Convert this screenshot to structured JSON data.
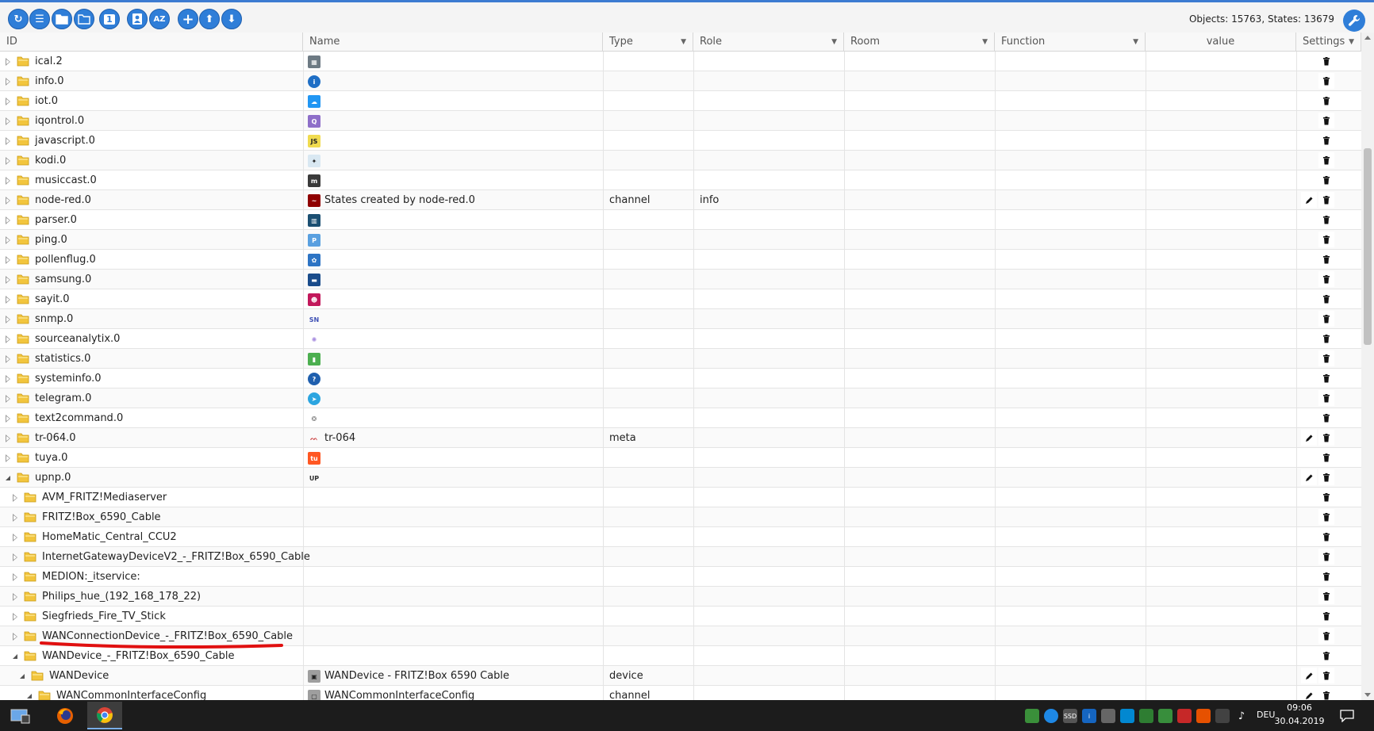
{
  "toolbar": {
    "buttons": [
      {
        "name": "refresh",
        "glyph": "↻"
      },
      {
        "name": "list-view",
        "glyph": "☰"
      },
      {
        "name": "collapse-all",
        "glyph": ""
      },
      {
        "name": "expand-all",
        "glyph": ""
      },
      {
        "name": "level",
        "glyph": "1"
      },
      {
        "name": "edit-object",
        "glyph": ""
      },
      {
        "name": "sort",
        "glyph": "AZ"
      },
      {
        "name": "add",
        "glyph": "+"
      },
      {
        "name": "upload",
        "glyph": "⬆"
      },
      {
        "name": "download",
        "glyph": "⬇"
      }
    ],
    "counts": "Objects: 15763, States: 13679"
  },
  "columns": [
    {
      "key": "id",
      "label": "ID",
      "filter": false
    },
    {
      "key": "name",
      "label": "Name",
      "filter": false
    },
    {
      "key": "type",
      "label": "Type",
      "filter": true
    },
    {
      "key": "role",
      "label": "Role",
      "filter": true
    },
    {
      "key": "room",
      "label": "Room",
      "filter": true
    },
    {
      "key": "function",
      "label": "Function",
      "filter": true
    },
    {
      "key": "value",
      "label": "value",
      "filter": false
    },
    {
      "key": "settings",
      "label": "Settings",
      "filter": true
    }
  ],
  "rows": [
    {
      "id": "ical.2",
      "level": 0,
      "expanded": false,
      "icon": "calendar",
      "icon_color": "#6d7a83",
      "name": "",
      "type": "",
      "role": "",
      "edit": false
    },
    {
      "id": "info.0",
      "level": 0,
      "expanded": false,
      "icon": "info",
      "icon_color": "#1f6fc5",
      "name": "",
      "type": "",
      "role": "",
      "edit": false
    },
    {
      "id": "iot.0",
      "level": 0,
      "expanded": false,
      "icon": "cloud",
      "icon_color": "#2196f3",
      "name": "",
      "type": "",
      "role": "",
      "edit": false
    },
    {
      "id": "iqontrol.0",
      "level": 0,
      "expanded": false,
      "icon": "iqontrol",
      "icon_color": "#8e6fc9",
      "name": "",
      "type": "",
      "role": "",
      "edit": false
    },
    {
      "id": "javascript.0",
      "level": 0,
      "expanded": false,
      "icon": "js",
      "icon_color": "#f0db4f",
      "name": "",
      "type": "",
      "role": "",
      "edit": false
    },
    {
      "id": "kodi.0",
      "level": 0,
      "expanded": false,
      "icon": "kodi",
      "icon_color": "#d9e8f2",
      "name": "",
      "type": "",
      "role": "",
      "edit": false
    },
    {
      "id": "musiccast.0",
      "level": 0,
      "expanded": false,
      "icon": "musiccast",
      "icon_color": "#3a3a3a",
      "name": "",
      "type": "",
      "role": "",
      "edit": false
    },
    {
      "id": "node-red.0",
      "level": 0,
      "expanded": false,
      "icon": "node-red",
      "icon_color": "#8f0000",
      "name": "States created by node-red.0",
      "type": "channel",
      "role": "info",
      "edit": true
    },
    {
      "id": "parser.0",
      "level": 0,
      "expanded": false,
      "icon": "parser",
      "icon_color": "#1b4f72",
      "name": "",
      "type": "",
      "role": "",
      "edit": false
    },
    {
      "id": "ping.0",
      "level": 0,
      "expanded": false,
      "icon": "ping",
      "icon_color": "#5aa0e0",
      "name": "",
      "type": "",
      "role": "",
      "edit": false
    },
    {
      "id": "pollenflug.0",
      "level": 0,
      "expanded": false,
      "icon": "pollen",
      "icon_color": "#2d74c4",
      "name": "",
      "type": "",
      "role": "",
      "edit": false
    },
    {
      "id": "samsung.0",
      "level": 0,
      "expanded": false,
      "icon": "samsung",
      "icon_color": "#1a4c8b",
      "name": "",
      "type": "",
      "role": "",
      "edit": false
    },
    {
      "id": "sayit.0",
      "level": 0,
      "expanded": false,
      "icon": "sayit",
      "icon_color": "#c2185b",
      "name": "",
      "type": "",
      "role": "",
      "edit": false
    },
    {
      "id": "snmp.0",
      "level": 0,
      "expanded": false,
      "icon": "snmp",
      "icon_color": "#3f51b5",
      "name": "",
      "type": "",
      "role": "",
      "edit": false
    },
    {
      "id": "sourceanalytix.0",
      "level": 0,
      "expanded": false,
      "icon": "sourceanalytix",
      "icon_color": "#a98fe0",
      "name": "",
      "type": "",
      "role": "",
      "edit": false
    },
    {
      "id": "statistics.0",
      "level": 0,
      "expanded": false,
      "icon": "statistics",
      "icon_color": "#4caf50",
      "name": "",
      "type": "",
      "role": "",
      "edit": false
    },
    {
      "id": "systeminfo.0",
      "level": 0,
      "expanded": false,
      "icon": "question",
      "icon_color": "#1f5fae",
      "name": "",
      "type": "",
      "role": "",
      "edit": false
    },
    {
      "id": "telegram.0",
      "level": 0,
      "expanded": false,
      "icon": "telegram",
      "icon_color": "#2ca5e0",
      "name": "",
      "type": "",
      "role": "",
      "edit": false
    },
    {
      "id": "text2command.0",
      "level": 0,
      "expanded": false,
      "icon": "brain",
      "icon_color": "#777777",
      "name": "",
      "type": "",
      "role": "",
      "edit": false
    },
    {
      "id": "tr-064.0",
      "level": 0,
      "expanded": false,
      "icon": "avm",
      "icon_color": "#c62828",
      "name": "tr-064",
      "type": "meta",
      "role": "",
      "edit": true
    },
    {
      "id": "tuya.0",
      "level": 0,
      "expanded": false,
      "icon": "tuya",
      "icon_color": "#ff5722",
      "name": "",
      "type": "",
      "role": "",
      "edit": false
    },
    {
      "id": "upnp.0",
      "level": 0,
      "expanded": true,
      "icon": "upnp",
      "icon_color": "#333333",
      "name": "",
      "type": "",
      "role": "",
      "edit": true
    },
    {
      "id": "AVM_FRITZ!Mediaserver",
      "level": 1,
      "expanded": false,
      "icon": "",
      "icon_color": "",
      "name": "",
      "type": "",
      "role": "",
      "edit": false
    },
    {
      "id": "FRITZ!Box_6590_Cable",
      "level": 1,
      "expanded": false,
      "icon": "",
      "icon_color": "",
      "name": "",
      "type": "",
      "role": "",
      "edit": false
    },
    {
      "id": "HomeMatic_Central_CCU2",
      "level": 1,
      "expanded": false,
      "icon": "",
      "icon_color": "",
      "name": "",
      "type": "",
      "role": "",
      "edit": false
    },
    {
      "id": "InternetGatewayDeviceV2_-_FRITZ!Box_6590_Cable",
      "level": 1,
      "expanded": false,
      "icon": "",
      "icon_color": "",
      "name": "",
      "type": "",
      "role": "",
      "edit": false
    },
    {
      "id": "MEDION:_itservice:",
      "level": 1,
      "expanded": false,
      "icon": "",
      "icon_color": "",
      "name": "",
      "type": "",
      "role": "",
      "edit": false
    },
    {
      "id": "Philips_hue_(192_168_178_22)",
      "level": 1,
      "expanded": false,
      "icon": "",
      "icon_color": "",
      "name": "",
      "type": "",
      "role": "",
      "edit": false
    },
    {
      "id": "Siegfrieds_Fire_TV_Stick",
      "level": 1,
      "expanded": false,
      "icon": "",
      "icon_color": "",
      "name": "",
      "type": "",
      "role": "",
      "edit": false
    },
    {
      "id": "WANConnectionDevice_-_FRITZ!Box_6590_Cable",
      "level": 1,
      "expanded": false,
      "icon": "",
      "icon_color": "",
      "name": "",
      "type": "",
      "role": "",
      "edit": false
    },
    {
      "id": "WANDevice_-_FRITZ!Box_6590_Cable",
      "level": 1,
      "expanded": true,
      "icon": "",
      "icon_color": "",
      "name": "",
      "type": "",
      "role": "",
      "edit": false
    },
    {
      "id": "WANDevice",
      "level": 2,
      "expanded": true,
      "icon": "device",
      "icon_color": "#9e9e9e",
      "name": "WANDevice - FRITZ!Box 6590 Cable",
      "type": "device",
      "role": "",
      "edit": true
    },
    {
      "id": "WANCommonInterfaceConfig",
      "level": 3,
      "expanded": true,
      "icon": "channel",
      "icon_color": "#9e9e9e",
      "name": "WANCommonInterfaceConfig",
      "type": "channel",
      "role": "",
      "edit": true
    }
  ],
  "taskbar": {
    "language": "DEU",
    "time": "09:06",
    "date": "30.04.2019"
  },
  "colors": {
    "accent": "#2f7ed8",
    "folder": "#f2c53d",
    "annotation": "#e01010"
  }
}
